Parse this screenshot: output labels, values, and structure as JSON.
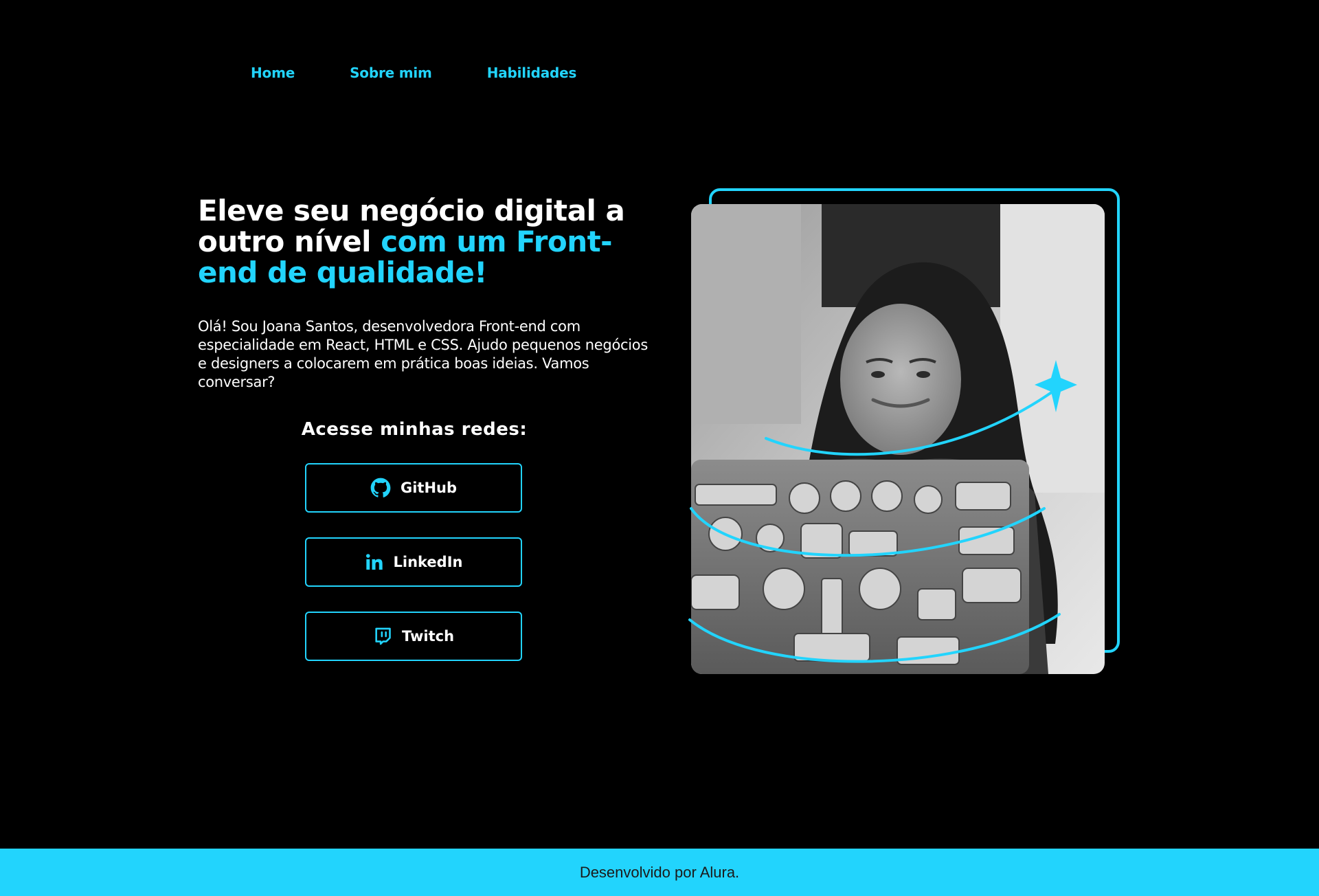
{
  "nav": {
    "items": [
      {
        "label": "Home"
      },
      {
        "label": "Sobre mim"
      },
      {
        "label": "Habilidades"
      }
    ]
  },
  "hero": {
    "title_part1": "Eleve seu negócio digital a outro nível ",
    "title_part2": "com um Front-end de qualidade!",
    "description": "Olá! Sou Joana Santos, desenvolvedora Front-end com especialidade em React, HTML e CSS. Ajudo pequenos negócios e designers a colocarem em prática boas ideias. Vamos conversar?"
  },
  "social": {
    "heading": "Acesse minhas redes:",
    "buttons": [
      {
        "label": "GitHub",
        "icon": "github-icon"
      },
      {
        "label": "LinkedIn",
        "icon": "linkedin-icon"
      },
      {
        "label": "Twitch",
        "icon": "twitch-icon"
      }
    ]
  },
  "footer": {
    "text": "Desenvolvido por Alura."
  },
  "colors": {
    "background": "#000000",
    "accent": "#22d4fd",
    "text": "#ffffff",
    "footer_text": "#1a1a1a"
  }
}
